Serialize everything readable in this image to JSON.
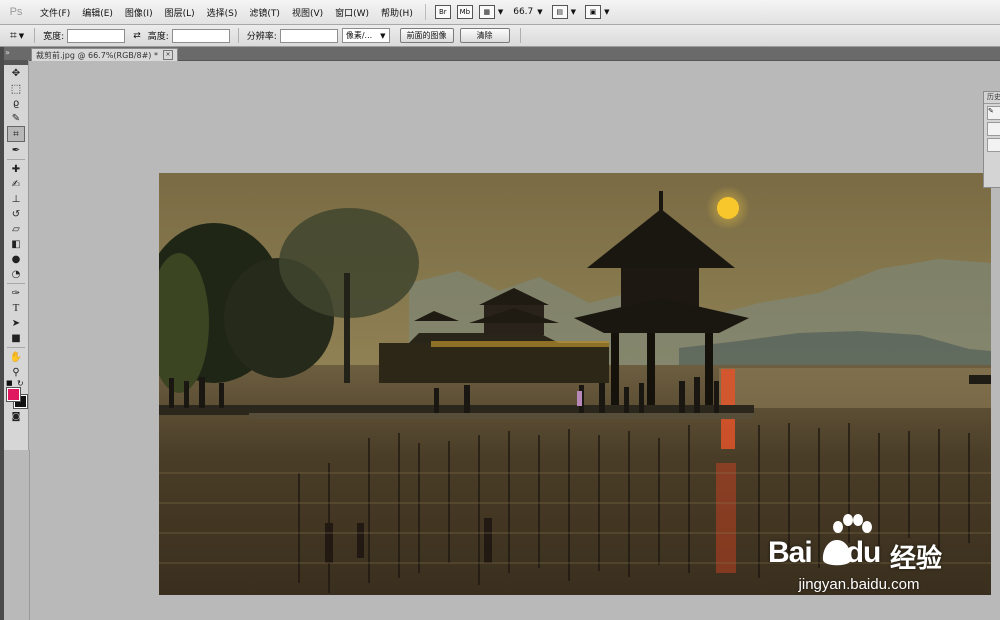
{
  "app": {
    "logo": "Ps"
  },
  "menu": {
    "items": [
      "文件(F)",
      "编辑(E)",
      "图像(I)",
      "图层(L)",
      "选择(S)",
      "滤镜(T)",
      "视图(V)",
      "窗口(W)",
      "帮助(H)"
    ],
    "icons": [
      "bridge-icon",
      "mini-bridge-icon",
      "view-extras-icon",
      "arrange-documents-icon",
      "screen-mode-icon"
    ],
    "zoom": "66.7",
    "mb_label": "Mb"
  },
  "options": {
    "width_label": "宽度:",
    "width_value": "",
    "swap_symbol": "⇄",
    "height_label": "高度:",
    "height_value": "",
    "resolution_label": "分辨率:",
    "resolution_value": "",
    "unit_select": "像素/...",
    "front_image_button": "前面的图像",
    "clear_button": "清除"
  },
  "document": {
    "tab_title": "裁剪前.jpg @ 66.7%(RGB/8#) *",
    "close_symbol": "×"
  },
  "tools": [
    "move-tool",
    "marquee-tool",
    "lasso-tool",
    "quick-select-tool",
    "crop-tool",
    "eyedropper-tool",
    "healing-brush-tool",
    "brush-tool",
    "clone-stamp-tool",
    "history-brush-tool",
    "eraser-tool",
    "gradient-tool",
    "blur-tool",
    "dodge-tool",
    "pen-tool",
    "type-tool",
    "path-select-tool",
    "rectangle-tool",
    "hand-tool",
    "zoom-tool"
  ],
  "colors": {
    "foreground": "#e0185f",
    "background": "#111111",
    "accent": "#f3b629"
  },
  "history_panel": {
    "title": "历史"
  },
  "watermark": {
    "brand_bai": "Bai",
    "brand_du": "du",
    "brand_jingyan": "经验",
    "url": "jingyan.baidu.com"
  }
}
